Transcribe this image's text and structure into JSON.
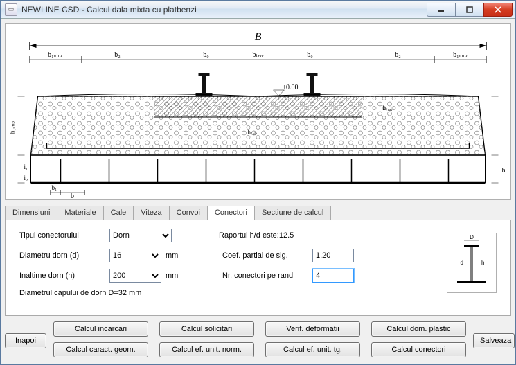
{
  "window": {
    "title": "NEWLINE CSD - Calcul dala mixta cu platbenzi"
  },
  "diagram": {
    "labels": {
      "B": "B",
      "b_timp_l": "b₁ᵢₘₚ",
      "b_timp_r": "b₁ᵢₘₚ",
      "b2": "b₂",
      "b0_l": "b₀",
      "b0_r": "b₀",
      "b_trav": "bₜᵣₐᵥ",
      "h_timp": "h₁ᵢₘₚ",
      "h_top": "hₜₒₚ",
      "h_trav": "hₜᵣₐᵥ",
      "h": "h",
      "b": "b",
      "b1": "b₁",
      "zero": "±0.00",
      "i": "i₁",
      "i2": "i₂"
    }
  },
  "tabs": {
    "dimensiuni": "Dimensiuni",
    "materiale": "Materiale",
    "cale": "Cale",
    "viteza": "Viteza",
    "convoi": "Convoi",
    "conectori": "Conectori",
    "sectiune": "Sectiune de calcul"
  },
  "form": {
    "tip_label": "Tipul conectorului",
    "tip_value": "Dorn",
    "diam_label": "Diametru dorn (d)",
    "diam_value": "16",
    "diam_unit": "mm",
    "inaltime_label": "Inaltime dorn (h)",
    "inaltime_value": "200",
    "inaltime_unit": "mm",
    "cap_note": "Diametrul capului de dorn D=32 mm",
    "raport_label": "Raportul h/d este:12.5",
    "coef_label": "Coef. partial de sig.",
    "coef_value": "1.20",
    "nr_label": "Nr. conectori pe rand",
    "nr_value": "4",
    "schematic": {
      "D": "D",
      "d": "d",
      "h": "h"
    }
  },
  "buttons": {
    "inapoi": "Inapoi",
    "salveaza": "Salveaza",
    "calc_incarcari": "Calcul incarcari",
    "calc_solicitari": "Calcul solicitari",
    "verif_deformatii": "Verif. deformatii",
    "calc_dom_plastic": "Calcul dom. plastic",
    "calc_caract_geom": "Calcul caract. geom.",
    "calc_ef_unit_norm": "Calcul ef. unit. norm.",
    "calc_ef_unit_tg": "Calcul ef. unit. tg.",
    "calc_conectori": "Calcul conectori"
  }
}
